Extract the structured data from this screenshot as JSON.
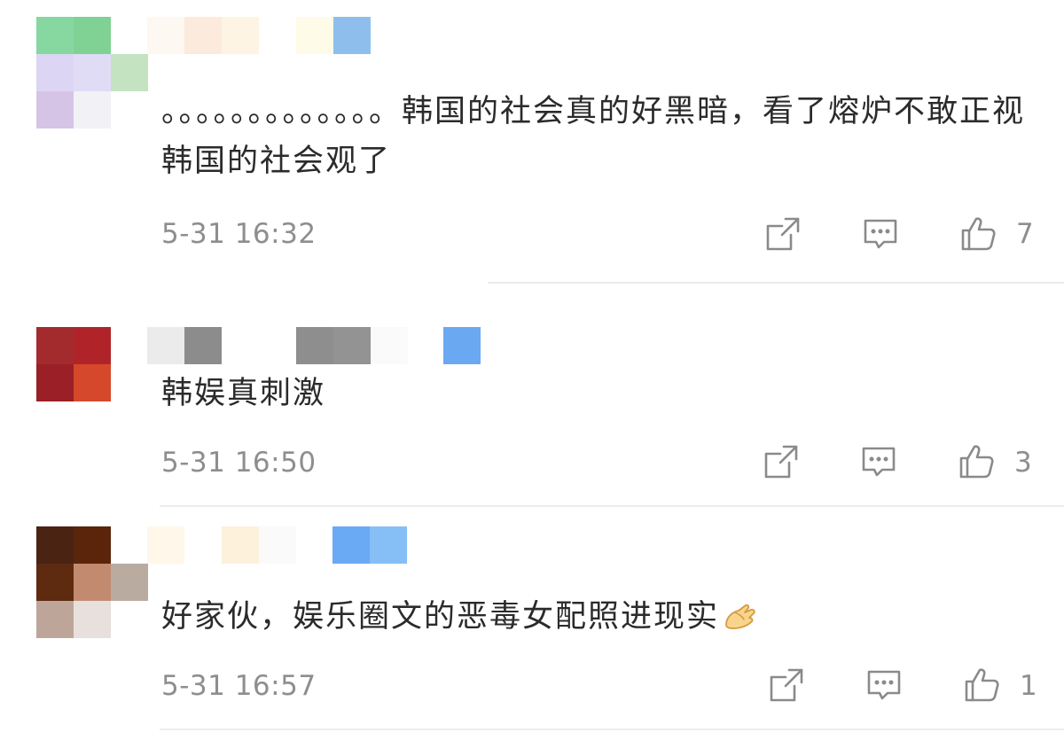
{
  "comments": [
    {
      "avatar_colors": [
        "#86d7a0",
        "#7fd294",
        "#dcd6f4",
        "#e0dcf6",
        "#c4e3c0",
        "#d6c4e6",
        "#f1f1f6"
      ],
      "username_colors": [
        "#fdf8f1",
        "#fcebdd",
        "#fdf4e3",
        "#fefbe8",
        "#8ebfec"
      ],
      "text": "。。。。。。。。。。。。。韩国的社会真的好黑暗，看了熔炉不敢正视韩国的社会观了",
      "timestamp": "5-31 16:32",
      "like_count": "7"
    },
    {
      "avatar_colors": [
        "#a32b2d",
        "#b02429",
        "#9a1f26",
        "#d6482c"
      ],
      "username_colors": [
        "#ebebeb",
        "#8c8c8c",
        "#8e8e8e",
        "#939393",
        "#fafafa",
        "#6aa9f1"
      ],
      "text": "韩娱真刺激",
      "timestamp": "5-31 16:50",
      "like_count": "3"
    },
    {
      "avatar_colors": [
        "#4a2312",
        "#5a250a",
        "#5e2a10",
        "#c28b70",
        "#b9aba0",
        "#bda699",
        "#e7e0dc"
      ],
      "username_colors": [
        "#fff7e9",
        "#fdf1dc",
        "#fafafa",
        "#6aa9f4",
        "#85bff5"
      ],
      "text": "好家伙，娱乐圈文的恶毒女配照进现实",
      "timestamp": "5-31 16:57",
      "like_count": "1"
    }
  ]
}
